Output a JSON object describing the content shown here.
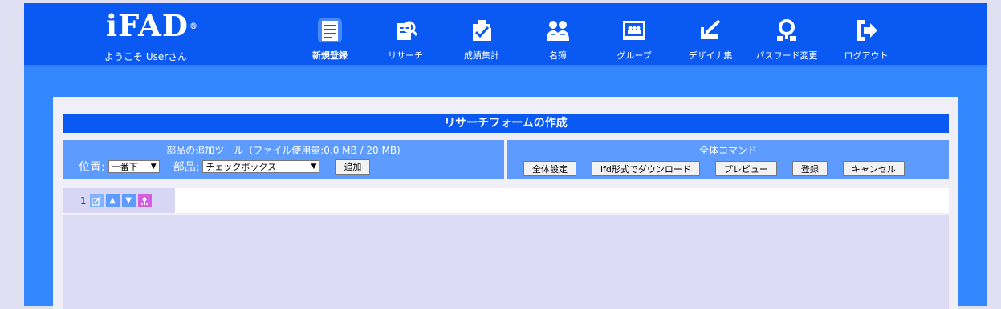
{
  "brand": {
    "logo": "iFAD",
    "registered": "®",
    "welcome": "ようこそ Userさん"
  },
  "nav": [
    {
      "label": "新規登録",
      "icon": "new-form-icon",
      "active": true
    },
    {
      "label": "リサーチ",
      "icon": "research-icon"
    },
    {
      "label": "成績集計",
      "icon": "results-icon"
    },
    {
      "label": "名簿",
      "icon": "roster-icon"
    },
    {
      "label": "グループ",
      "icon": "group-icon"
    },
    {
      "label": "デザイナ集",
      "icon": "designer-icon"
    },
    {
      "label": "パスワード変更",
      "icon": "password-icon"
    },
    {
      "label": "ログアウト",
      "icon": "logout-icon"
    }
  ],
  "page": {
    "title": "リサーチフォームの作成"
  },
  "add_tool": {
    "title": "部品の追加ツール（ファイル使用量:0.0 MB / 20 MB)",
    "position_label": "位置:",
    "position_value": "一番下",
    "part_label": "部品:",
    "part_value": "チェックボックス",
    "add_button": "追加"
  },
  "commands": {
    "title": "全体コマンド",
    "buttons": [
      "全体設定",
      "ifd形式でダウンロード",
      "プレビュー",
      "登録",
      "キャンセル"
    ]
  },
  "items": [
    {
      "number": "1"
    }
  ],
  "colors": {
    "header": "#0a59f2",
    "accent": "#3388ff",
    "panel": "#5e9bff"
  }
}
